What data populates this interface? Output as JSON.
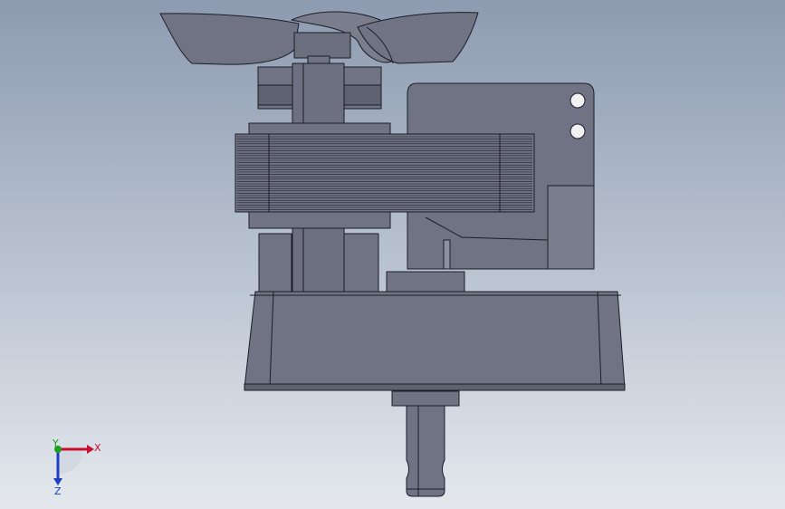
{
  "viewport": {
    "triad": {
      "x_label": "X",
      "y_label": "Y",
      "z_label": "Z",
      "x_color": "#c8102e",
      "y_color": "#1fa01f",
      "z_color": "#1c3fbf"
    },
    "model": {
      "body_color": "#6f7384",
      "shade_color": "#5d6170",
      "light_color": "#8a8e9c",
      "edge_color": "#1b1d26",
      "hole_color": "#f2f2f4"
    }
  }
}
